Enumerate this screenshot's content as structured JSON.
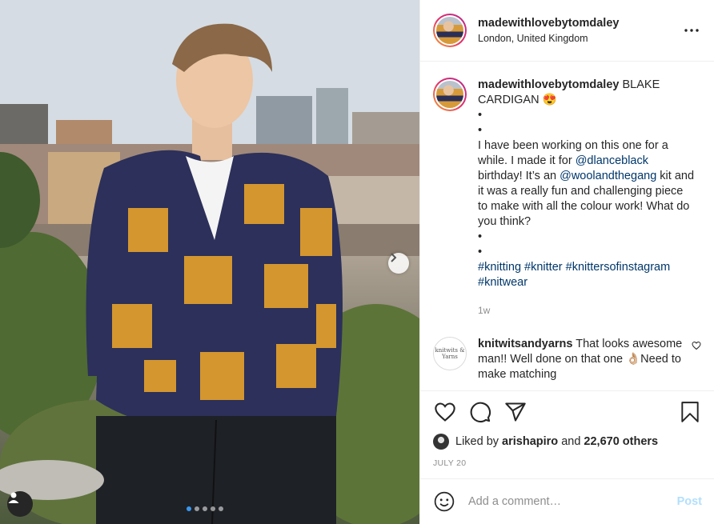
{
  "post": {
    "username": "madewithlovebytomdaley",
    "location": "London, United Kingdom",
    "caption": {
      "username": "madewithlovebytomdaley",
      "title": "BLAKE CARDIGAN 😍",
      "dot1": "•",
      "dot2": "•",
      "text_before": "I have been working on this one for a while. I made it for",
      "mention1": "@dlanceblack",
      "text_mid": "birthday! It’s an",
      "mention2": "@woolandthegang",
      "text_after": "kit and it was a really fun and challenging piece to make with all the colour work! What do you think?",
      "dot3": "•",
      "dot4": "•",
      "hashtags": [
        "#knitting",
        "#knitter",
        "#knittersofinstagram",
        "#knitwear"
      ],
      "time": "1w"
    },
    "comments": [
      {
        "username": "knitwitsandyarns",
        "avatar_text": "knitwits & Yarns",
        "text": "That looks awesome man!! Well done on that one 👌🏼Need to make matching"
      }
    ],
    "likes": {
      "prefix": "Liked by",
      "user": "arishapiro",
      "and": "and",
      "count": "22,670 others"
    },
    "date": "JULY 20",
    "add_comment_placeholder": "Add a comment…",
    "post_label": "Post",
    "carousel": {
      "total": 5,
      "active": 1
    }
  },
  "colors": {
    "link": "#00376b",
    "active_dot": "#3897f0",
    "post_button": "#b2dffc",
    "muted": "#8e8e8e"
  },
  "icons": [
    "ellipsis-icon",
    "chevron-right-icon",
    "user-tag-icon",
    "heart-icon",
    "comment-icon",
    "share-icon",
    "bookmark-icon",
    "emoji-icon"
  ]
}
